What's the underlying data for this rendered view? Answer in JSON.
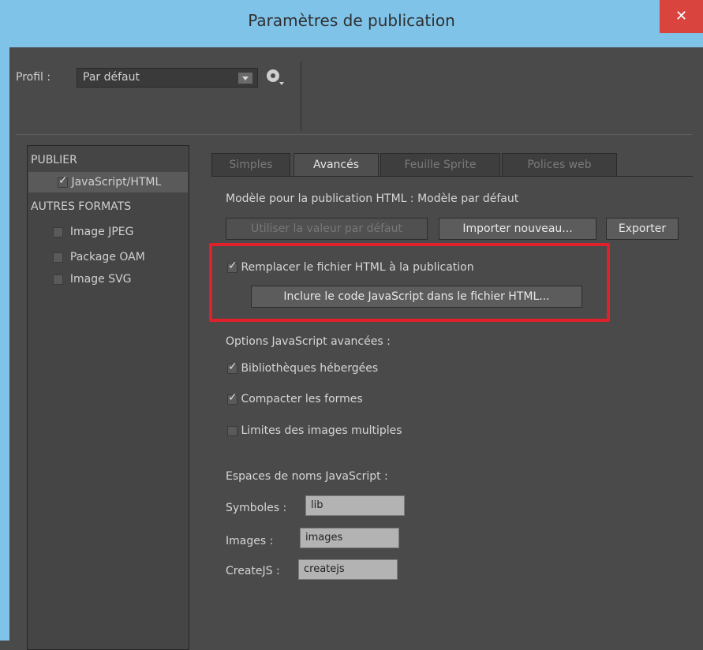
{
  "window": {
    "title": "Paramètres de publication",
    "close_label": "✕"
  },
  "profile": {
    "label": "Profil :",
    "value": "Par défaut"
  },
  "left_panel": {
    "publish_header": "PUBLIER",
    "publish_items": [
      {
        "label": "JavaScript/HTML",
        "checked": true
      }
    ],
    "other_header": "AUTRES FORMATS",
    "other_items": [
      {
        "label": "Image JPEG",
        "checked": false
      },
      {
        "label": "Package OAM",
        "checked": false
      },
      {
        "label": "Image SVG",
        "checked": false
      }
    ]
  },
  "tabs": [
    "Simples",
    "Avancés",
    "Feuille Sprite",
    "Polices web"
  ],
  "active_tab": "Avancés",
  "template": {
    "label": "Modèle pour la publication HTML : Modèle par défaut",
    "use_default_btn": "Utiliser la valeur par défaut",
    "import_btn": "Importer nouveau...",
    "export_btn": "Exporter"
  },
  "overwrite": {
    "label": "Remplacer le fichier HTML à la publication",
    "checked": true,
    "include_js_btn": "Inclure le code JavaScript dans le fichier HTML..."
  },
  "js_options": {
    "header": "Options JavaScript avancées :",
    "items": [
      {
        "label": "Bibliothèques hébergées",
        "checked": true
      },
      {
        "label": "Compacter les formes",
        "checked": true
      },
      {
        "label": "Limites des images multiples",
        "checked": false
      }
    ]
  },
  "namespaces": {
    "header": "Espaces de noms JavaScript :",
    "symbols_label": "Symboles :",
    "symbols_value": "lib",
    "images_label": "Images :",
    "images_value": "images",
    "createjs_label": "CreateJS :",
    "createjs_value": "createjs"
  },
  "colors": {
    "titlebar": "#7fc3e9",
    "close": "#d9443e",
    "highlight": "#e0202a",
    "bg": "#4a4a4a"
  }
}
